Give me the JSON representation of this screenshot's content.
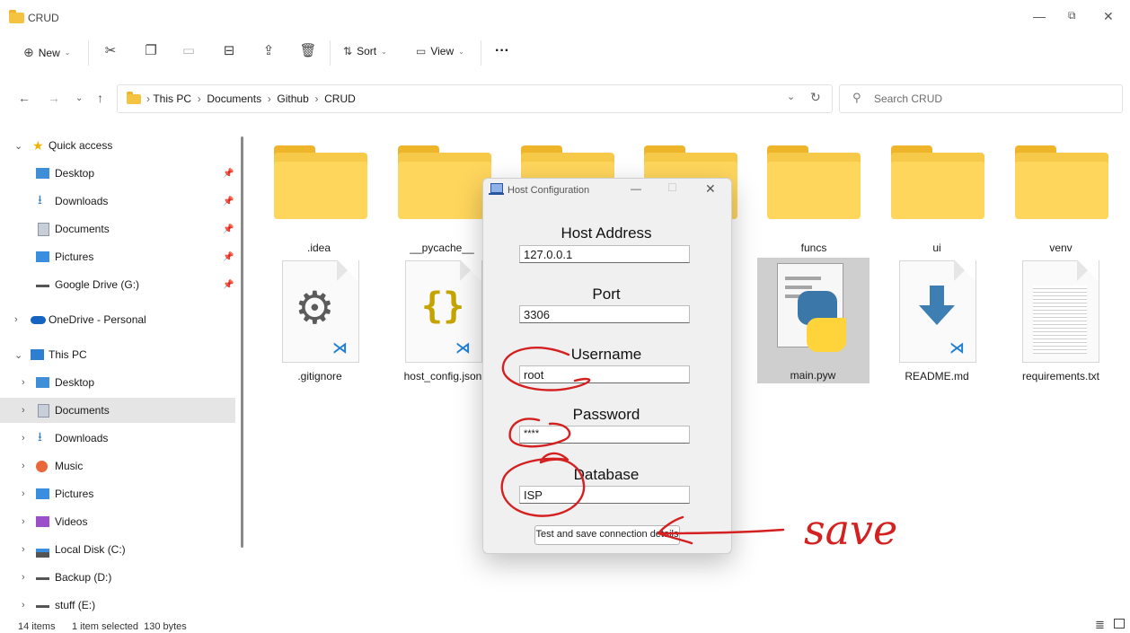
{
  "window": {
    "title": "CRUD"
  },
  "toolbar": {
    "new_label": "New",
    "sort_label": "Sort",
    "view_label": "View",
    "more_label": "···"
  },
  "address": {
    "crumbs": [
      "This PC",
      "Documents",
      "Github",
      "CRUD"
    ],
    "search_placeholder": "Search CRUD"
  },
  "sidebar": {
    "items": [
      {
        "label": "Quick access"
      },
      {
        "label": "Desktop"
      },
      {
        "label": "Downloads"
      },
      {
        "label": "Documents"
      },
      {
        "label": "Pictures"
      },
      {
        "label": "Google Drive (G:)"
      },
      {
        "label": "OneDrive - Personal"
      },
      {
        "label": "This PC"
      },
      {
        "label": "Desktop"
      },
      {
        "label": "Documents"
      },
      {
        "label": "Downloads"
      },
      {
        "label": "Music"
      },
      {
        "label": "Pictures"
      },
      {
        "label": "Videos"
      },
      {
        "label": "Local Disk (C:)"
      },
      {
        "label": "Backup (D:)"
      },
      {
        "label": "stuff (E:)"
      }
    ]
  },
  "files": {
    "folders": [
      ".idea",
      "__pycache__",
      "funcs",
      "ui",
      "venv"
    ],
    "docs": [
      ".gitignore",
      "host_config.json",
      "main.pyw",
      "README.md",
      "requirements.txt"
    ]
  },
  "dialog": {
    "title": "Host Configuration",
    "host_label": "Host Address",
    "host_value": "127.0.0.1",
    "port_label": "Port",
    "port_value": "3306",
    "user_label": "Username",
    "user_value": "root",
    "pass_label": "Password",
    "pass_value": "****",
    "db_label": "Database",
    "db_value": "ISP",
    "save_button": "Test and save connection details"
  },
  "status": {
    "items": "14 items",
    "selected": "1 item selected  130 bytes"
  },
  "annotation": {
    "text": "save",
    "color": "#d42020"
  }
}
